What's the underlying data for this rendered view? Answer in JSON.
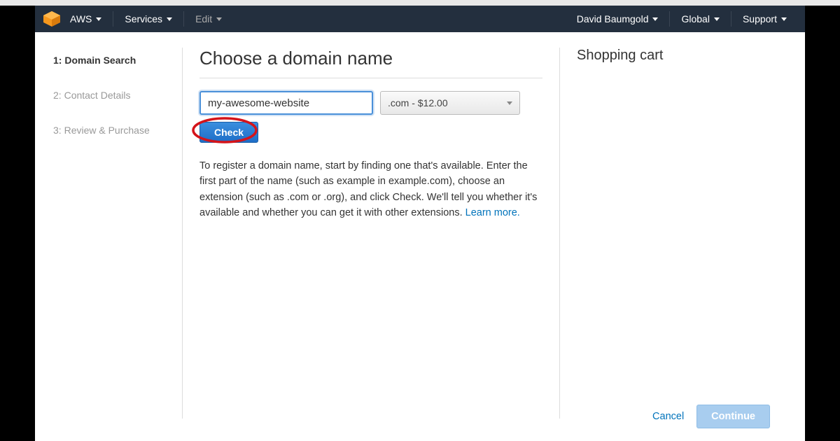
{
  "topbar": {
    "brand": "AWS",
    "services": "Services",
    "edit": "Edit",
    "user": "David Baumgold",
    "region": "Global",
    "support": "Support"
  },
  "sidebar": {
    "steps": [
      {
        "num": "1:",
        "label": "Domain Search"
      },
      {
        "num": "2:",
        "label": "Contact Details"
      },
      {
        "num": "3:",
        "label": "Review & Purchase"
      }
    ]
  },
  "main": {
    "heading": "Choose a domain name",
    "domain_value": "my-awesome-website",
    "tld_selected": ".com - $12.00",
    "check_label": "Check",
    "help_text": "To register a domain name, start by finding one that's available. Enter the first part of the name (such as example in example.com), choose an extension (such as .com or .org), and click Check. We'll tell you whether it's available and whether you can get it with other extensions.  ",
    "learn_more": "Learn more."
  },
  "cart": {
    "title": "Shopping cart"
  },
  "footer": {
    "cancel": "Cancel",
    "continue": "Continue"
  }
}
